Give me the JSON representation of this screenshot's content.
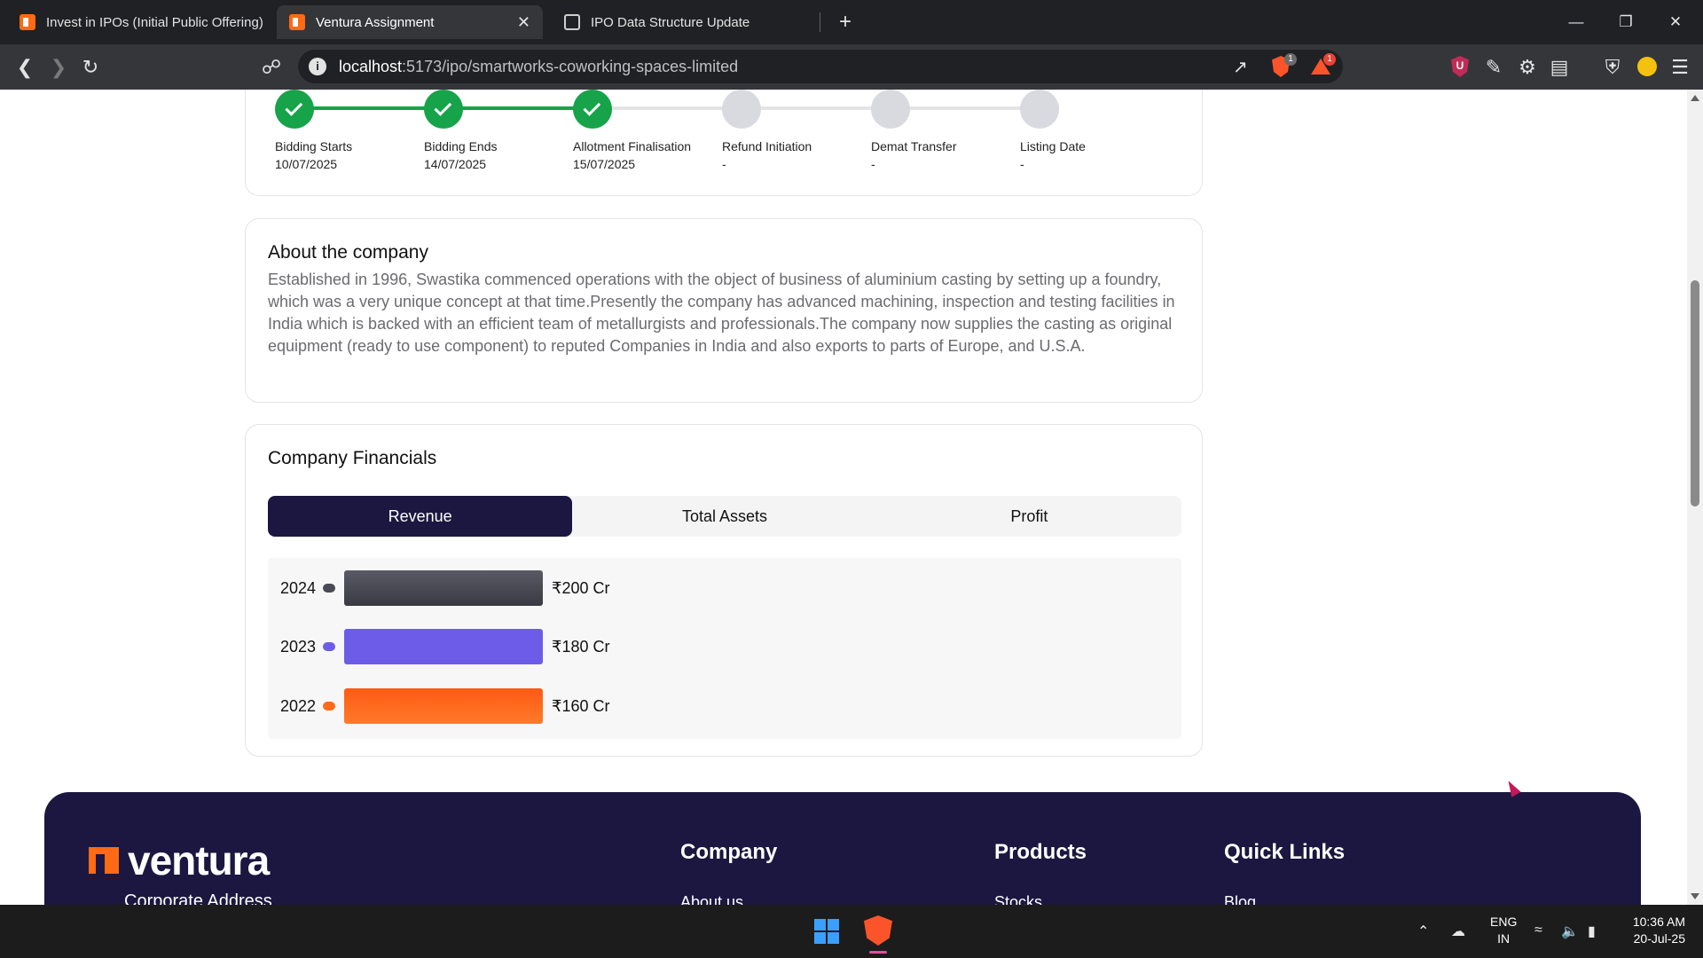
{
  "browser": {
    "tabs": [
      {
        "title": "Invest in IPOs (Initial Public Offering)",
        "icon": "ventura-favicon",
        "active": false
      },
      {
        "title": "Ventura Assignment",
        "icon": "ventura-favicon",
        "active": true
      },
      {
        "title": "IPO Data Structure Update",
        "icon": "openai-favicon",
        "active": false
      }
    ],
    "close_glyph": "✕",
    "new_tab_glyph": "+",
    "url_host": "localhost",
    "url_rest": ":5173/ipo/smartworks-coworking-spaces-limited",
    "shield_badge": "1",
    "rewards_badge": "1"
  },
  "timeline": {
    "steps": [
      {
        "label": "Bidding Starts",
        "date": "10/07/2025",
        "done": true
      },
      {
        "label": "Bidding Ends",
        "date": "14/07/2025",
        "done": true
      },
      {
        "label": "Allotment Finalisation",
        "date": "15/07/2025",
        "done": true
      },
      {
        "label": "Refund Initiation",
        "date": "-",
        "done": false
      },
      {
        "label": "Demat Transfer",
        "date": "-",
        "done": false
      },
      {
        "label": "Listing Date",
        "date": "-",
        "done": false
      }
    ],
    "colors": {
      "done": "#16a34a",
      "pending": "#d9d9e0",
      "line_done": "#16a34a",
      "line_pending": "#e4e4e7"
    }
  },
  "about": {
    "title": "About the company",
    "text": "Established in 1996, Swastika commenced operations with the object of business of aluminium casting by setting up a foundry, which was a very unique concept at that time.Presently the company has advanced machining, inspection and testing facilities in India which is backed with an efficient team of metallurgists and professionals.The company now supplies the casting as original equipment (ready to use component) to reputed Companies in India and also exports to parts of Europe, and U.S.A."
  },
  "financials": {
    "title": "Company Financials",
    "tabs": [
      "Revenue",
      "Total Assets",
      "Profit"
    ],
    "active_tab": "Revenue",
    "accent_color": "#1b1740"
  },
  "chart_data": {
    "type": "bar",
    "orientation": "horizontal",
    "categories": [
      "2024",
      "2023",
      "2022"
    ],
    "values": [
      200,
      180,
      160
    ],
    "value_labels": [
      "₹200 Cr",
      "₹180 Cr",
      "₹160 Cr"
    ],
    "colors": [
      "#4a4a55",
      "#6c5ce7",
      "#ff6b1a"
    ],
    "title": "",
    "xlabel": "",
    "ylabel": "",
    "grid": false
  },
  "footer": {
    "brand": "ventura",
    "sub_heading": "Corporate Address",
    "columns": [
      {
        "title": "Company",
        "first_link": "About us"
      },
      {
        "title": "Products",
        "first_link": "Stocks"
      },
      {
        "title": "Quick Links",
        "first_link": "Blog"
      }
    ]
  },
  "taskbar": {
    "lang_line1": "ENG",
    "lang_line2": "IN",
    "time": "10:36 AM",
    "date": "20-Jul-25"
  }
}
